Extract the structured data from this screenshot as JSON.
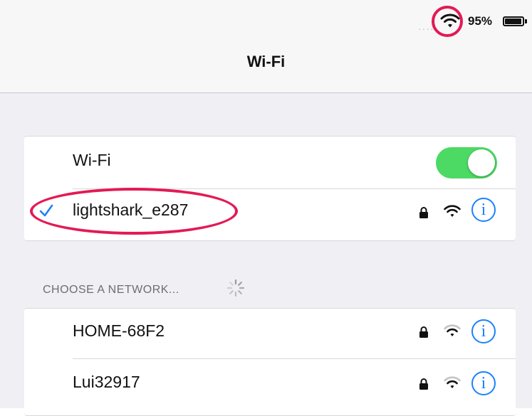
{
  "status_bar": {
    "signal_dots": "·····",
    "battery_percent": "95%",
    "wifi_icon": "wifi-icon",
    "battery_icon": "battery-icon"
  },
  "nav": {
    "title": "Wi-Fi"
  },
  "wifi_toggle": {
    "label": "Wi-Fi",
    "on": true,
    "color": "#4cd964"
  },
  "connected": {
    "name": "lightshark_e287",
    "secured": true,
    "checkmark_icon": "checkmark-icon",
    "info_glyph": "i"
  },
  "choose_network": {
    "header": "CHOOSE A NETWORK...",
    "networks": [
      {
        "name": "HOME-68F2",
        "secured": true,
        "info_glyph": "i"
      },
      {
        "name": "Lui32917",
        "secured": true,
        "info_glyph": "i"
      }
    ]
  },
  "annotation_color": "#e21a55",
  "accent": "#1a82fb"
}
